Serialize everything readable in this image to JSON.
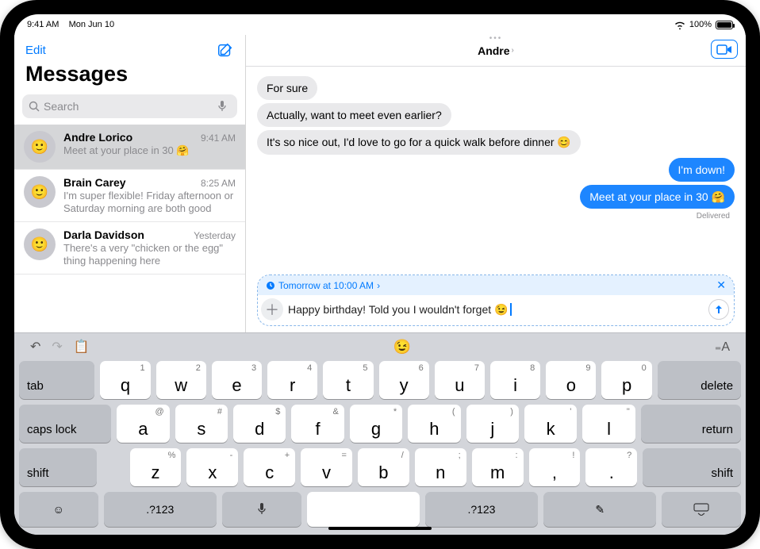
{
  "status": {
    "time": "9:41 AM",
    "date": "Mon Jun 10",
    "battery": "100%"
  },
  "sidebar": {
    "edit": "Edit",
    "title": "Messages",
    "search_placeholder": "Search",
    "conversations": [
      {
        "name": "Andre Lorico",
        "time": "9:41 AM",
        "preview": "Meet at your place in 30 🤗",
        "selected": true
      },
      {
        "name": "Brain Carey",
        "time": "8:25 AM",
        "preview": "I'm super flexible! Friday afternoon or Saturday morning are both good",
        "selected": false
      },
      {
        "name": "Darla Davidson",
        "time": "Yesterday",
        "preview": "There's a very \"chicken or the egg\" thing happening here",
        "selected": false
      }
    ]
  },
  "conversation": {
    "title": "Andre",
    "messages": [
      {
        "side": "left",
        "text": "For sure"
      },
      {
        "side": "left",
        "text": "Actually, want to meet even earlier?"
      },
      {
        "side": "left",
        "text": "It's so nice out, I'd love to go for a quick walk before dinner 😊"
      },
      {
        "side": "right",
        "text": "I'm down!"
      },
      {
        "side": "right",
        "text": "Meet at your place in 30 🤗"
      }
    ],
    "delivered": "Delivered",
    "compose": {
      "schedule_label": "Tomorrow at 10:00 AM",
      "draft": "Happy birthday! Told you I wouldn't forget 😉"
    }
  },
  "keyboard": {
    "suggestion_emoji": "😉",
    "row1": [
      {
        "main": "q",
        "alt": "1"
      },
      {
        "main": "w",
        "alt": "2"
      },
      {
        "main": "e",
        "alt": "3"
      },
      {
        "main": "r",
        "alt": "4"
      },
      {
        "main": "t",
        "alt": "5"
      },
      {
        "main": "y",
        "alt": "6"
      },
      {
        "main": "u",
        "alt": "7"
      },
      {
        "main": "i",
        "alt": "8"
      },
      {
        "main": "o",
        "alt": "9"
      },
      {
        "main": "p",
        "alt": "0"
      }
    ],
    "row2": [
      {
        "main": "a",
        "alt": "@"
      },
      {
        "main": "s",
        "alt": "#"
      },
      {
        "main": "d",
        "alt": "$"
      },
      {
        "main": "f",
        "alt": "&"
      },
      {
        "main": "g",
        "alt": "*"
      },
      {
        "main": "h",
        "alt": "("
      },
      {
        "main": "j",
        "alt": ")"
      },
      {
        "main": "k",
        "alt": "'"
      },
      {
        "main": "l",
        "alt": "\""
      }
    ],
    "row3": [
      {
        "main": "z",
        "alt": "%"
      },
      {
        "main": "x",
        "alt": "-"
      },
      {
        "main": "c",
        "alt": "+"
      },
      {
        "main": "v",
        "alt": "="
      },
      {
        "main": "b",
        "alt": "/"
      },
      {
        "main": "n",
        "alt": ";"
      },
      {
        "main": "m",
        "alt": ":"
      },
      {
        "main": ",",
        "alt": "!"
      },
      {
        "main": ".",
        "alt": "?"
      }
    ],
    "labels": {
      "tab": "tab",
      "delete": "delete",
      "caps": "caps lock",
      "return": "return",
      "shift": "shift",
      "num": ".?123"
    }
  }
}
